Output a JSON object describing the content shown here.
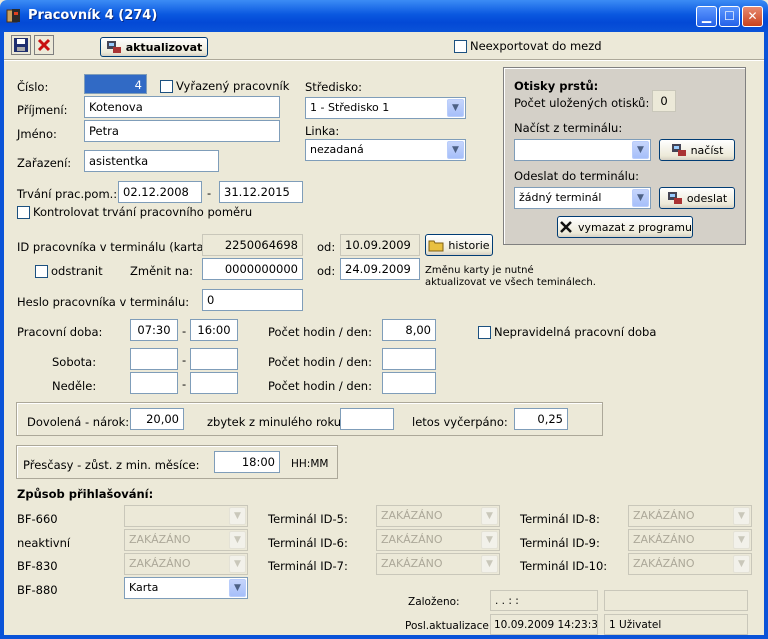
{
  "window": {
    "title": "Pracovník 4 (274)"
  },
  "toolbar": {
    "refresh_label": "aktualizovat",
    "no_export_label": "Neexportovat do mezd"
  },
  "employee": {
    "number_label": "Číslo:",
    "number": "4",
    "excluded_label": "Vyřazený pracovník",
    "surname_label": "Příjmení:",
    "surname": "Kotenova",
    "name_label": "Jméno:",
    "name": "Petra",
    "position_label": "Zařazení:",
    "position": "asistentka",
    "duration_label": "Trvání prac.pom.:",
    "date_from": "02.12.2008",
    "date_dash": "-",
    "date_to": "31.12.2015",
    "check_duration_label": "Kontrolovat trvání pracovního poměru",
    "center_label": "Středisko:",
    "center": "1 - Středisko 1",
    "line_label": "Linka:",
    "line": "nezadaná"
  },
  "fingerprints": {
    "title": "Otisky prstů:",
    "stored_label": "Počet uložených otisků:",
    "stored": "0",
    "load_label": "Načíst z terminálu:",
    "load_value": "",
    "load_button": "načíst",
    "send_label": "Odeslat do terminálu:",
    "send_value": "žádný terminál",
    "send_button": "odeslat",
    "delete_button": "vymazat z programu"
  },
  "card": {
    "id_label": "ID pracovníka v terminálu (karta):",
    "id": "2250064698",
    "from_label": "od:",
    "from_date": "10.09.2009",
    "history_button": "historie",
    "remove_label": "odstranit",
    "change_label": "Změnit na:",
    "new_id": "0000000000",
    "from2_label": "od:",
    "from2_date": "24.09.2009",
    "note_line1": "Změnu karty je nutné",
    "note_line2": "aktualizovat ve všech teminálech.",
    "password_label": "Heslo pracovníka v terminálu:",
    "password": "0"
  },
  "worktime": {
    "label": "Pracovní doba:",
    "from": "07:30",
    "dash": "-",
    "to": "16:00",
    "hours_label": "Počet hodin / den:",
    "hours": "8,00",
    "irregular_label": "Nepravidelná pracovní doba",
    "saturday_label": "Sobota:",
    "sunday_label": "Neděle:"
  },
  "vacation": {
    "entitlement_label": "Dovolená - nárok:",
    "entitlement": "20,00",
    "remainder_label": "zbytek z minulého roku:",
    "remainder": "",
    "used_label": "letos vyčerpáno:",
    "used": "0,25"
  },
  "overtime": {
    "label": "Přesčasy - zůst. z min. měsíce:",
    "value": "18:00",
    "unit": "HH:MM"
  },
  "login": {
    "title": "Způsob přihlašování:",
    "disabled": "ZAKÁZÁNO",
    "rows": [
      {
        "label": "BF-660",
        "value": ""
      },
      {
        "label": "neaktivní",
        "value": "ZAKÁZÁNO"
      },
      {
        "label": "BF-830",
        "value": "ZAKÁZÁNO"
      },
      {
        "label": "BF-880",
        "value": "Karta"
      }
    ],
    "terminals_a": [
      {
        "label": "Terminál ID-5:",
        "value": "ZAKÁZÁNO"
      },
      {
        "label": "Terminál ID-6:",
        "value": "ZAKÁZÁNO"
      },
      {
        "label": "Terminál ID-7:",
        "value": "ZAKÁZÁNO"
      }
    ],
    "terminals_b": [
      {
        "label": "Terminál ID-8:",
        "value": "ZAKÁZÁNO"
      },
      {
        "label": "Terminál ID-9:",
        "value": "ZAKÁZÁNO"
      },
      {
        "label": "Terminál ID-10:",
        "value": "ZAKÁZÁNO"
      }
    ]
  },
  "audit": {
    "created_label": "Založeno:",
    "created": ".  .      :  :",
    "created_user": "",
    "updated_label": "Posl.aktualizace:",
    "updated": "10.09.2009 14:23:35",
    "updated_user": "1 Uživatel"
  }
}
